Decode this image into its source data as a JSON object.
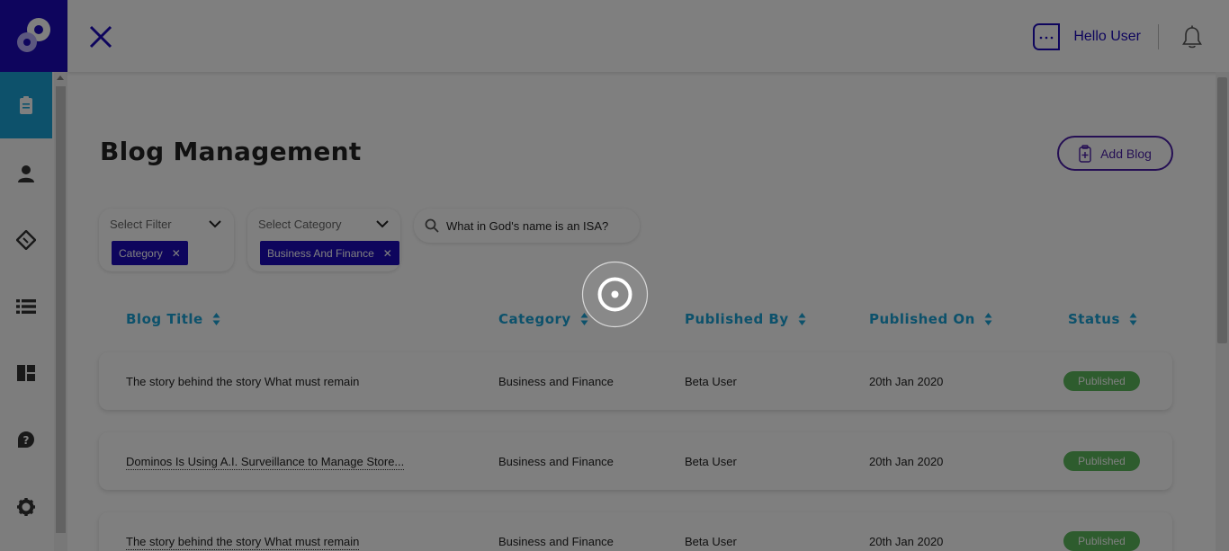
{
  "header": {
    "user_name": "Hello User"
  },
  "sidebar": {
    "items": [
      {
        "name": "blog",
        "icon": "clipboard-icon",
        "active": true
      },
      {
        "name": "users",
        "icon": "user-icon",
        "active": false
      },
      {
        "name": "tickets",
        "icon": "ticket-icon",
        "active": false
      },
      {
        "name": "list",
        "icon": "list-icon",
        "active": false
      },
      {
        "name": "dashboard",
        "icon": "dashboard-icon",
        "active": false
      },
      {
        "name": "help",
        "icon": "help-icon",
        "active": false
      },
      {
        "name": "settings",
        "icon": "gear-icon",
        "active": false
      }
    ]
  },
  "page": {
    "title": "Blog Management",
    "add_button_label": "Add Blog"
  },
  "filters": {
    "filter": {
      "label": "Select Filter",
      "chip": "Category"
    },
    "category": {
      "label": "Select Category",
      "chip": "Business And Finance"
    },
    "search": {
      "value": "What in God's name is an ISA?"
    }
  },
  "table": {
    "columns": [
      "Blog Title",
      "Category",
      "Published By",
      "Published On",
      "Status"
    ],
    "rows": [
      {
        "title": "The story behind the story What must remain",
        "category": "Business and Finance",
        "published_by": "Beta User",
        "published_on": "20th Jan 2020",
        "status": "Published"
      },
      {
        "title": "Dominos Is Using A.I. Surveillance to Manage Store...",
        "category": "Business and Finance",
        "published_by": "Beta User",
        "published_on": "20th Jan 2020",
        "status": "Published"
      },
      {
        "title": "The story behind the story What must remain",
        "category": "Business and Finance",
        "published_by": "Beta User",
        "published_on": "20th Jan 2020",
        "status": "Published"
      }
    ]
  },
  "colors": {
    "brand": "#1d0bbb",
    "accent": "#1aa3d6",
    "status_published": "#5cb85c",
    "add_button": "#4a1fa8"
  }
}
